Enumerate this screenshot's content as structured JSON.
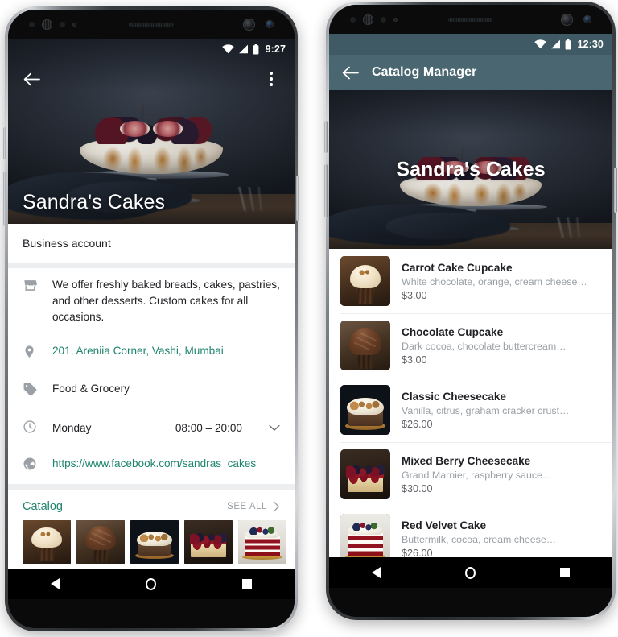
{
  "left_phone": {
    "status_bar": {
      "time": "9:27",
      "icons": [
        "wifi-icon",
        "cellular-signal-icon",
        "battery-icon"
      ]
    },
    "app_bar": {
      "back_icon": "arrow-back-icon",
      "overflow_icon": "more-vert-icon"
    },
    "hero": {
      "title": "Sandra's Cakes",
      "image": "pavlova-cake-photo"
    },
    "account_row": {
      "label": "Business account"
    },
    "info_rows": [
      {
        "icon": "storefront-icon",
        "text": "We offer freshly baked breads, cakes, pastries, and other desserts. Custom cakes for all occasions.",
        "link": false
      },
      {
        "icon": "location-pin-icon",
        "text": "201, Areniia Corner, Vashi, Mumbai",
        "link": true
      },
      {
        "icon": "tag-icon",
        "text": "Food & Grocery",
        "link": false
      }
    ],
    "hours_row": {
      "icon": "clock-icon",
      "day": "Monday",
      "hours": "08:00 – 20:00",
      "expand_icon": "chevron-down-icon"
    },
    "website_row": {
      "icon": "globe-icon",
      "text": "https://www.facebook.com/sandras_cakes",
      "link": true
    },
    "catalog": {
      "title": "Catalog",
      "see_all": "SEE ALL",
      "see_all_icon": "chevron-right-icon",
      "thumbnails": [
        {
          "name": "Carrot Cake Cupcake",
          "art": "cc"
        },
        {
          "name": "Chocolate Cupcake",
          "art": "ch"
        },
        {
          "name": "Classic Cheesecake",
          "art": "cs"
        },
        {
          "name": "Mixed Berry Cheesecake",
          "art": "mb"
        },
        {
          "name": "Red Velvet Cake",
          "art": "rv"
        }
      ]
    },
    "nav_bar": {
      "back": "nav-back-icon",
      "home": "nav-home-icon",
      "recents": "nav-recents-icon"
    }
  },
  "right_phone": {
    "status_bar": {
      "time": "12:30",
      "icons": [
        "wifi-icon",
        "cellular-signal-icon",
        "battery-icon"
      ]
    },
    "app_bar": {
      "back_icon": "arrow-back-icon",
      "title": "Catalog Manager"
    },
    "hero": {
      "title": "Sandra's Cakes",
      "image": "pavlova-cake-photo"
    },
    "products": [
      {
        "name": "Carrot Cake Cupcake",
        "description": "White chocolate, orange, cream cheese…",
        "price": "$3.00",
        "art": "cc"
      },
      {
        "name": "Chocolate Cupcake",
        "description": "Dark cocoa, chocolate buttercream…",
        "price": "$3.00",
        "art": "ch"
      },
      {
        "name": "Classic Cheesecake",
        "description": "Vanilla, citrus, graham cracker crust…",
        "price": "$26.00",
        "art": "cs"
      },
      {
        "name": "Mixed Berry Cheesecake",
        "description": "Grand Marnier, raspberry sauce…",
        "price": "$30.00",
        "art": "mb"
      },
      {
        "name": "Red Velvet Cake",
        "description": "Buttermilk, cocoa, cream cheese…",
        "price": "$26.00",
        "art": "rv"
      }
    ],
    "nav_bar": {
      "back": "nav-back-icon",
      "home": "nav-home-icon",
      "recents": "nav-recents-icon"
    }
  },
  "colors": {
    "accent_teal": "#20856f",
    "appbar_slate": "#4a6670",
    "status_slate": "#3f5a64",
    "text_primary": "#202124",
    "text_secondary": "#9aa0a6",
    "page_bg": "#ffffff"
  }
}
